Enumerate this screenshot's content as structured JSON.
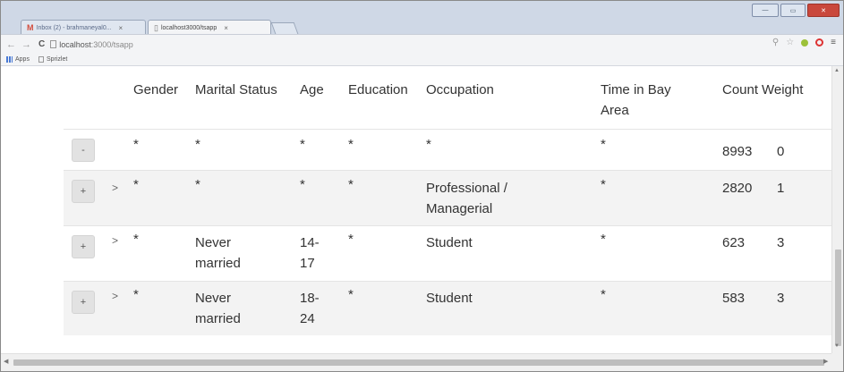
{
  "browser": {
    "tabs": [
      {
        "label": "Inbox (2) - brahmaneyal0...",
        "icon": "gmail-icon",
        "active": false
      },
      {
        "label": "localhost3000/tsapp",
        "icon": "page-icon",
        "active": true
      }
    ],
    "window_buttons": [
      "minimize",
      "restore",
      "close"
    ],
    "url_host": "localhost",
    "url_rest": ":3000/tsapp",
    "bookmarks": [
      {
        "label": "Apps"
      },
      {
        "label": "Sprizlet"
      }
    ]
  },
  "table": {
    "headers": {
      "gender": "Gender",
      "marital": "Marital Status",
      "age": "Age",
      "education": "Education",
      "occupation": "Occupation",
      "time_l1": "Time in Bay",
      "time_l2": "Area",
      "count": "Count",
      "weight": "Weight"
    },
    "rows": [
      {
        "button": "-",
        "arrow": "",
        "gender": "*",
        "marital_l1": "*",
        "marital_l2": "",
        "age_l1": "*",
        "age_l2": "",
        "education": "*",
        "occupation_l1": "*",
        "occupation_l2": "",
        "time": "*",
        "count": "8993",
        "weight": "0"
      },
      {
        "button": "+",
        "arrow": ">",
        "gender": "*",
        "marital_l1": "*",
        "marital_l2": "",
        "age_l1": "*",
        "age_l2": "",
        "education": "*",
        "occupation_l1": "Professional /",
        "occupation_l2": "Managerial",
        "time": "*",
        "count": "2820",
        "weight": "1"
      },
      {
        "button": "+",
        "arrow": ">",
        "gender": "*",
        "marital_l1": "Never",
        "marital_l2": "married",
        "age_l1": "14-",
        "age_l2": "17",
        "education": "*",
        "occupation_l1": "Student",
        "occupation_l2": "",
        "time": "*",
        "count": "623",
        "weight": "3"
      },
      {
        "button": "+",
        "arrow": ">",
        "gender": "*",
        "marital_l1": "Never",
        "marital_l2": "married",
        "age_l1": "18-",
        "age_l2": "24",
        "education": "*",
        "occupation_l1": "Student",
        "occupation_l2": "",
        "time": "*",
        "count": "583",
        "weight": "3"
      }
    ]
  }
}
